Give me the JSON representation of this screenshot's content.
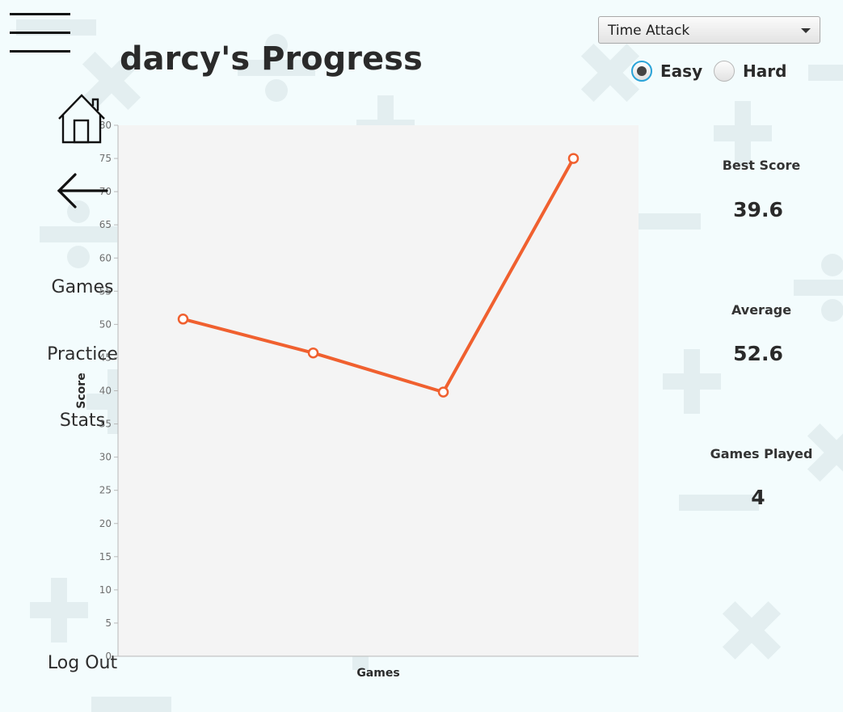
{
  "header": {
    "title": "darcy's Progress",
    "mode_select": {
      "value": "Time Attack"
    },
    "difficulty": [
      {
        "label": "Easy",
        "selected": true
      },
      {
        "label": "Hard",
        "selected": false
      }
    ]
  },
  "nav": {
    "icons": [
      "menu-icon",
      "home-icon",
      "back-arrow-icon"
    ],
    "links": [
      "Games",
      "Practice",
      "Stats"
    ],
    "logout": "Log Out"
  },
  "stats": {
    "best_score_label": "Best Score",
    "best_score": "39.6",
    "average_label": "Average",
    "average": "52.6",
    "games_played_label": "Games Played",
    "games_played": "4"
  },
  "colors": {
    "background": "#f3fcfd",
    "plot_background": "#f4f4f4",
    "series": "#f0602f",
    "radio_focus": "#2aa3d8"
  },
  "chart_data": {
    "type": "line",
    "xlabel": "Games",
    "ylabel": "Score",
    "ylim": [
      0,
      80
    ],
    "ytick_step": 5,
    "x": [
      1,
      2,
      3,
      4
    ],
    "series": [
      {
        "values": [
          50.8,
          45.7,
          39.8,
          75.0
        ]
      }
    ]
  }
}
